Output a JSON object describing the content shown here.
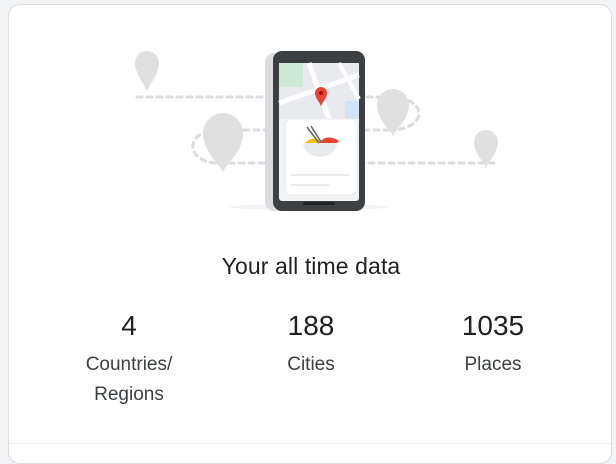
{
  "card": {
    "title": "Your all time data",
    "stats": [
      {
        "value": "4",
        "label": "Countries/\nRegions"
      },
      {
        "value": "188",
        "label": "Cities"
      },
      {
        "value": "1035",
        "label": "Places"
      }
    ]
  },
  "illustration": {
    "icon": "phone-map-icon",
    "colors": {
      "pin_gray": "#dadce0",
      "map_pin": "#ea4335",
      "phone_body": "#3c4043",
      "bowl_red": "#ea4335",
      "bowl_yellow": "#fbbc04"
    }
  }
}
